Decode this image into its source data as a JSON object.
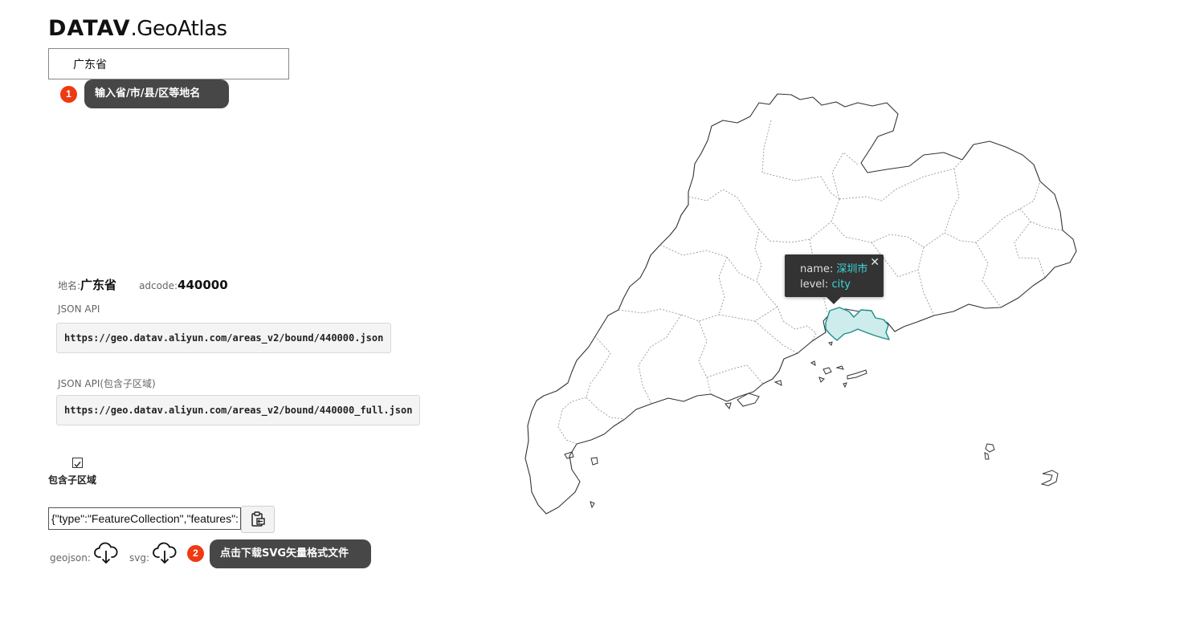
{
  "logo": {
    "bold": "DATAV",
    "light": ".GeoAtlas"
  },
  "search": {
    "value": "广东省"
  },
  "steps": [
    {
      "num": "1",
      "text": "输入省/市/县/区等地名"
    },
    {
      "num": "2",
      "text": "点击下载SVG矢量格式文件"
    }
  ],
  "info": {
    "name_label": "地名:",
    "name_value": "广东省",
    "adcode_label": "adcode:",
    "adcode_value": "440000"
  },
  "api": [
    {
      "label": "JSON API",
      "url": "https://geo.datav.aliyun.com/areas_v2/bound/440000.json"
    },
    {
      "label": "JSON API(包含子区域)",
      "url": "https://geo.datav.aliyun.com/areas_v2/bound/440000_full.json"
    }
  ],
  "include_sub": {
    "label": "包含子区域",
    "checked": true
  },
  "geojson_field": {
    "value": "{\"type\":\"FeatureCollection\",\"features\":["
  },
  "downloads": {
    "geojson_label": "geojson:",
    "svg_label": "svg:"
  },
  "tooltip": {
    "name_key": "name:",
    "name_value": "深圳市",
    "level_key": "level:",
    "level_value": "city",
    "close": "✕"
  },
  "colors": {
    "accent": "#ee3a12",
    "tooltip_bg": "#333333",
    "tooltip_value": "#3dd4d9",
    "highlight_fill": "#cdeceb",
    "highlight_stroke": "#1a8e8a"
  },
  "icons": [
    "cloud-download-icon",
    "clipboard-copy-icon",
    "checkbox-icon",
    "close-icon"
  ]
}
